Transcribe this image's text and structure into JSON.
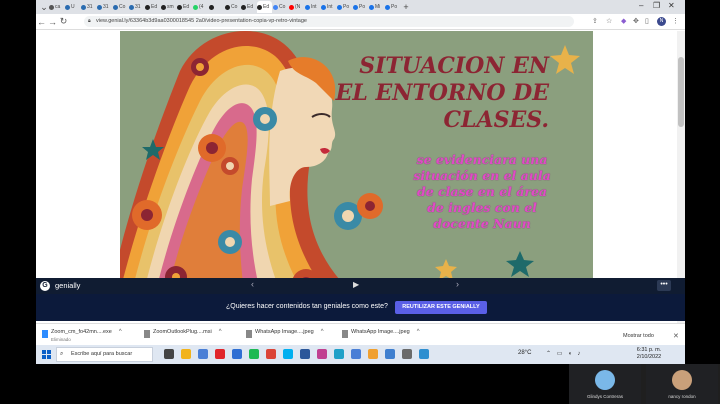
{
  "browser": {
    "tabs": [
      {
        "label": "ca",
        "color": "#555"
      },
      {
        "label": "U",
        "color": "#2b6cb0"
      },
      {
        "label": "31",
        "color": "#2b6cb0"
      },
      {
        "label": "31",
        "color": "#2b6cb0"
      },
      {
        "label": "Co",
        "color": "#2b6cb0"
      },
      {
        "label": "31",
        "color": "#2b6cb0"
      },
      {
        "label": "Ed",
        "color": "#222"
      },
      {
        "label": "sm",
        "color": "#222"
      },
      {
        "label": "Ed",
        "color": "#222"
      },
      {
        "label": "(4",
        "color": "#25d366"
      },
      {
        "label": "",
        "color": "#222"
      },
      {
        "label": "Co",
        "color": "#222"
      },
      {
        "label": "Ed",
        "color": "#222"
      },
      {
        "label": "Ed",
        "color": "#222"
      },
      {
        "label": "Co",
        "color": "#4285f4"
      },
      {
        "label": "(N",
        "color": "#ff0000"
      },
      {
        "label": "Int",
        "color": "#1a73e8"
      },
      {
        "label": "Int",
        "color": "#1a73e8"
      },
      {
        "label": "Po",
        "color": "#1a73e8"
      },
      {
        "label": "Po",
        "color": "#1a73e8"
      },
      {
        "label": "Mi",
        "color": "#1a73e8"
      },
      {
        "label": "Po",
        "color": "#1a73e8"
      }
    ],
    "new_tab": "+",
    "url": "view.genial.ly/63364b3d9aa0300018545 2a0/video-presentation-copia-vp-retro-vintage",
    "profile_initial": "N"
  },
  "slide": {
    "title_lines": [
      "SITUACION EN",
      "EL ENTORNO DE",
      "CLASES."
    ],
    "body_lines": [
      "se evidenciara una",
      "situación en el aula",
      "de clase en el área",
      "de ingles con el",
      "docente Naun"
    ]
  },
  "genially": {
    "brand": "genially",
    "logo_letter": "G",
    "prev": "‹",
    "play": "▶",
    "next": "›",
    "menu": "•••",
    "question": "¿Quieres hacer contenidos tan geniales como este?",
    "reuse_button": "REUTILIZAR ESTE GENIALLY"
  },
  "downloads": {
    "items": [
      {
        "name": "Zoom_cm_fo42mn....exe",
        "status": "Eliminado",
        "color": "#2d8cff"
      },
      {
        "name": "ZoomOutlookPlug....msi",
        "status": "",
        "color": "#555"
      },
      {
        "name": "WhatsApp Image....jpeg",
        "status": "",
        "color": "#555"
      },
      {
        "name": "WhatsApp Image....jpeg",
        "status": "",
        "color": "#555"
      }
    ],
    "show_all": "Mostrar todo",
    "close": "✕"
  },
  "taskbar": {
    "search_placeholder": "Escribe aquí para buscar",
    "weather": "28°C",
    "time": "6:31 p. m.",
    "date": "2/10/2022",
    "apps": [
      {
        "name": "task-view-icon",
        "color": "#444"
      },
      {
        "name": "file-explorer-icon",
        "color": "#f2b31b"
      },
      {
        "name": "windows-store-icon",
        "color": "#4a7fd6"
      },
      {
        "name": "opera-icon",
        "color": "#e0252a"
      },
      {
        "name": "mail-icon",
        "color": "#2f6fd3"
      },
      {
        "name": "spotify-icon",
        "color": "#1db954"
      },
      {
        "name": "chrome-icon",
        "color": "#db4437"
      },
      {
        "name": "skype-icon",
        "color": "#00aff0"
      },
      {
        "name": "word-icon",
        "color": "#2b579a"
      },
      {
        "name": "photos-icon",
        "color": "#c04090"
      },
      {
        "name": "edge-icon",
        "color": "#1fa0c8"
      },
      {
        "name": "settings-icon",
        "color": "#4a7fd6"
      },
      {
        "name": "paint-icon",
        "color": "#f0a030"
      },
      {
        "name": "photo-viewer-icon",
        "color": "#3f7fcf"
      },
      {
        "name": "snip-icon",
        "color": "#6a6a6a"
      },
      {
        "name": "app-s-icon",
        "color": "#2f8fd0"
      }
    ]
  },
  "call": {
    "participants": [
      {
        "name": "Glindys Contreras",
        "avatar_color": "#7ab8e8"
      },
      {
        "name": "nancy rondon",
        "avatar_color": "#c9a07a"
      }
    ]
  }
}
